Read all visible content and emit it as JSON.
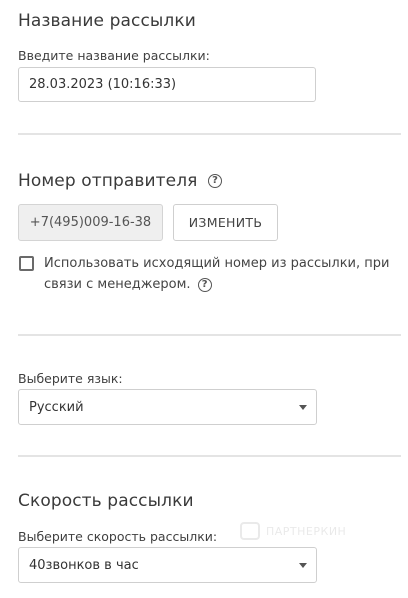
{
  "mailing_name": {
    "title": "Название рассылки",
    "label": "Введите название рассылки:",
    "value": "28.03.2023 (10:16:33)"
  },
  "sender_number": {
    "title": "Номер отправителя",
    "help_icon": "question-circle-icon",
    "phone_value": "+7(495)009-16-38",
    "change_button_label": "ИЗМЕНИТЬ",
    "use_outgoing_checkbox": {
      "checked": false,
      "label": "Использовать исходящий номер из рассылки, при связи с менеджером."
    }
  },
  "language": {
    "label": "Выберите язык:",
    "selected": "Русский"
  },
  "speed": {
    "title": "Скорость рассылки",
    "label": "Выберите скорость рассылки:",
    "selected": "40звонков в час"
  },
  "watermark": {
    "text": "ПАРТНЕРКИН"
  }
}
